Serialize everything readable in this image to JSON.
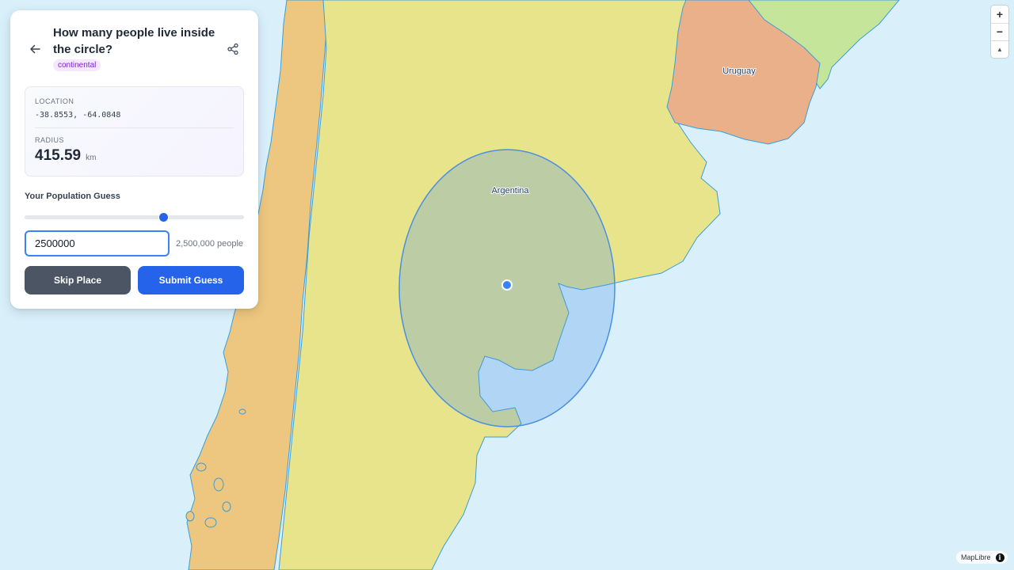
{
  "question": {
    "title": "How many people live inside the circle?",
    "tag": "continental"
  },
  "location": {
    "label": "LOCATION",
    "coords": "-38.8553, -64.0848"
  },
  "radius": {
    "label": "RADIUS",
    "value": "415.59",
    "unit": "km"
  },
  "guess": {
    "label": "Your Population Guess",
    "input_value": "2500000",
    "formatted": "2,500,000 people",
    "slider_fraction": 0.63
  },
  "buttons": {
    "skip": "Skip Place",
    "submit": "Submit Guess"
  },
  "map": {
    "labels": {
      "argentina": "Argentina",
      "uruguay": "Uruguay"
    },
    "colors": {
      "ocean": "#d9f0fb",
      "argentina": "#e8e48c",
      "chile": "#edc77f",
      "uruguay": "#e9b08a",
      "brazil": "#c5e59b",
      "coastline": "#3b9ed8",
      "circle": "#4a90e2"
    },
    "zoom_in": "+",
    "zoom_out": "−",
    "compass": "▲"
  },
  "attribution": {
    "text": "MapLibre",
    "icon": "i"
  }
}
